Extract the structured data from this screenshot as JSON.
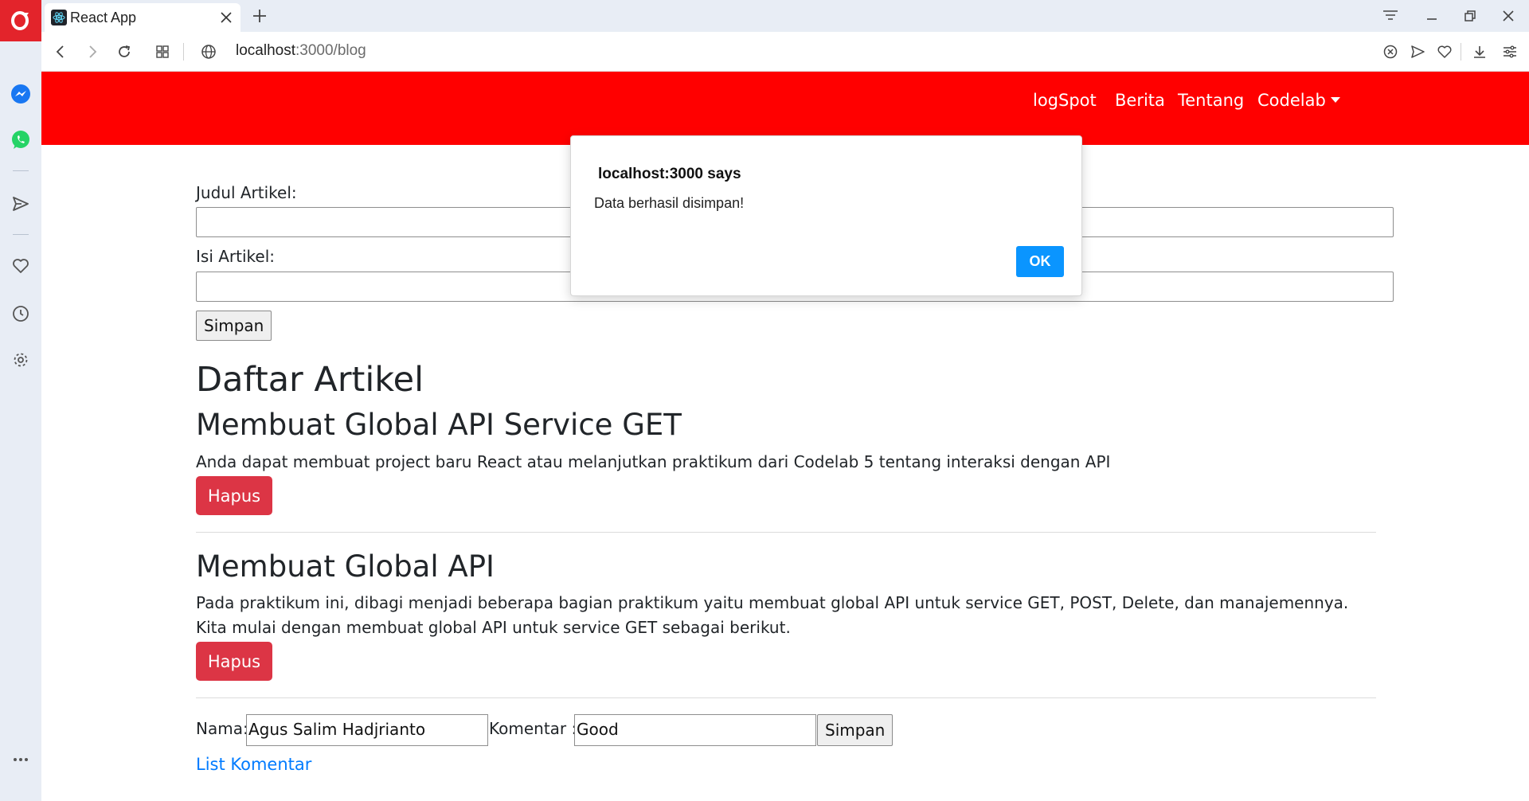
{
  "browser": {
    "tab_title": "React App",
    "url_host": "localhost",
    "url_path": ":3000/blog"
  },
  "navbar": {
    "links": [
      "logSpot",
      "Berita",
      "Tentang",
      "Codelab"
    ]
  },
  "form": {
    "title_label": "Judul Artikel:",
    "body_label": "Isi Artikel:",
    "submit_label": "Simpan"
  },
  "list": {
    "heading": "Daftar Artikel",
    "articles": [
      {
        "title": "Membuat Global API Service GET",
        "body": "Anda dapat membuat project baru React atau melanjutkan praktikum dari Codelab 5 tentang interaksi dengan API",
        "delete_label": "Hapus"
      },
      {
        "title": "Membuat Global API",
        "body": "Pada praktikum ini, dibagi menjadi beberapa bagian praktikum yaitu membuat global API untuk service GET, POST, Delete, dan manajemennya. Kita mulai dengan membuat global API untuk service GET sebagai berikut.",
        "delete_label": "Hapus"
      }
    ]
  },
  "comment": {
    "name_label": "Nama:",
    "name_value": "Agus Salim Hadjrianto",
    "comment_label": "Komentar :",
    "comment_value": "Good",
    "submit_label": "Simpan",
    "list_link": "List Komentar"
  },
  "dialog": {
    "title": "localhost:3000 says",
    "message": "Data berhasil disimpan!",
    "ok_label": "OK"
  },
  "colors": {
    "navbar": "#ff0000",
    "danger": "#dc3545",
    "link": "#007bff",
    "dialog_ok": "#0a95ff",
    "opera_red": "#e3242b"
  }
}
